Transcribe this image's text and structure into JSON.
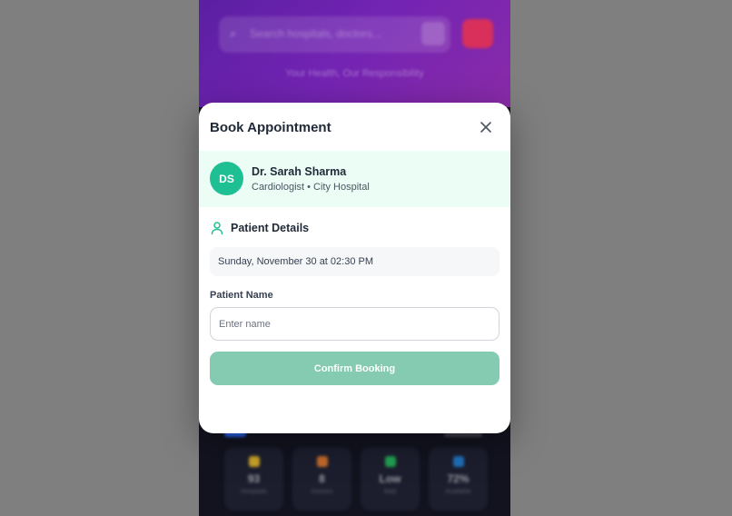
{
  "background": {
    "search_placeholder": "Search hospitals, doctors...",
    "tagline": "Your Health, Our Responsibility",
    "stats": [
      {
        "value": "93",
        "label": "Hospitals",
        "color": "#c9a227"
      },
      {
        "value": "8",
        "label": "Doctors",
        "color": "#c26a2b"
      },
      {
        "value": "Low",
        "label": "Wait",
        "color": "#22a052"
      },
      {
        "value": "72%",
        "label": "Available",
        "color": "#1f6fb8"
      }
    ]
  },
  "modal": {
    "title": "Book Appointment",
    "doctor": {
      "initials": "DS",
      "name": "Dr. Sarah Sharma",
      "meta": "Cardiologist • City Hospital"
    },
    "section_title": "Patient Details",
    "selected_slot": "Sunday, November 30 at 02:30 PM",
    "patient_name_label": "Patient Name",
    "patient_name_placeholder": "Enter name",
    "patient_name_value": "",
    "confirm_label": "Confirm Booking"
  },
  "colors": {
    "accent": "#1fbf94",
    "confirm_disabled": "#84cbb1",
    "doctor_card_bg": "#ecfdf5",
    "header_gradient_start": "#5b1fa3",
    "header_gradient_end": "#8a2ba8",
    "alert": "#d8305a"
  }
}
